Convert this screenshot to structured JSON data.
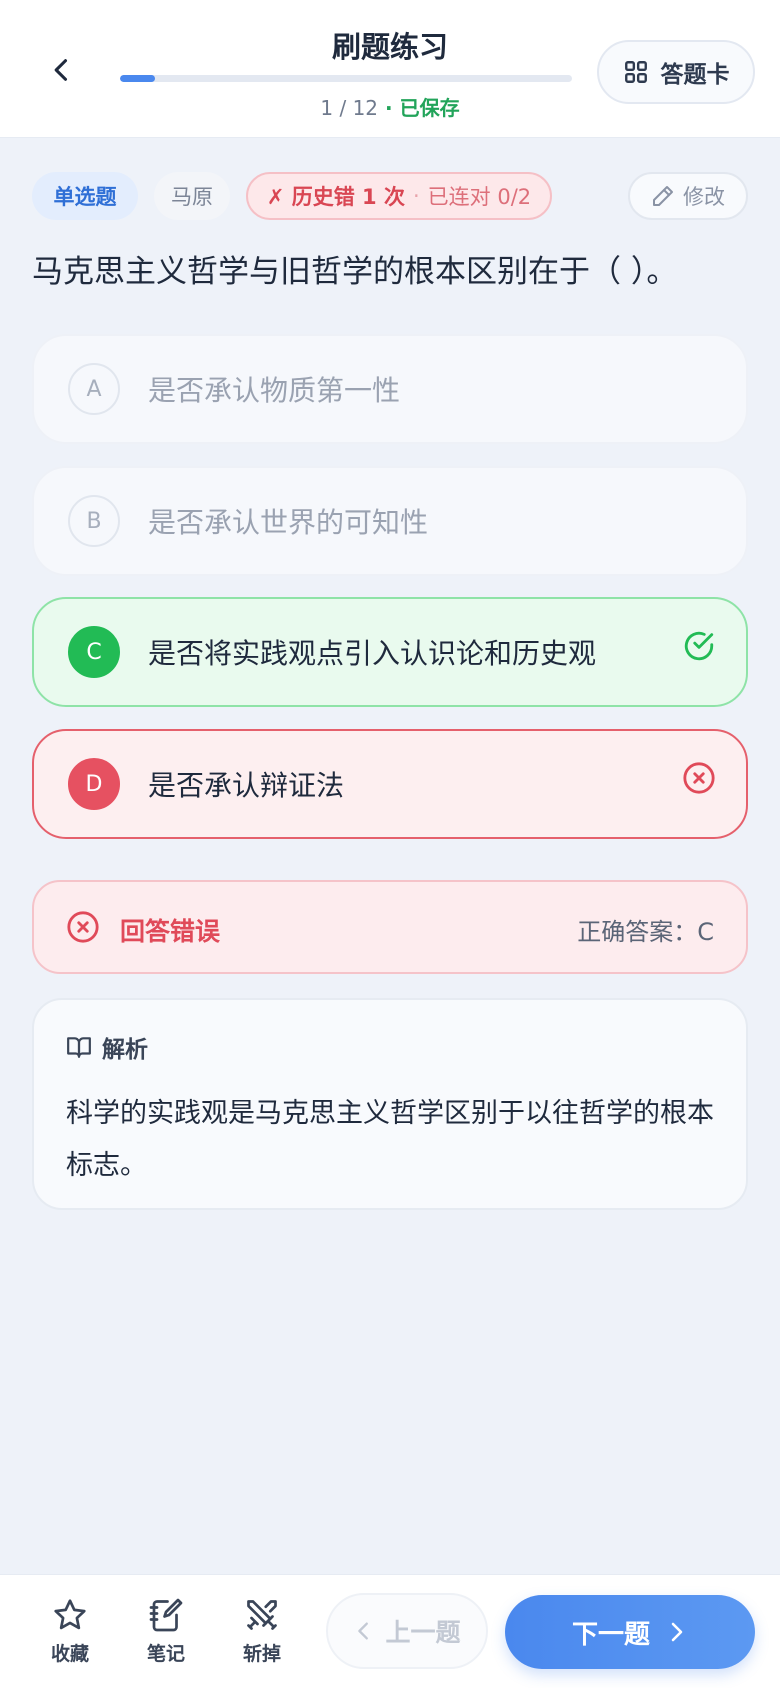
{
  "header": {
    "title": "刷题练习",
    "progress_text": "1 / 12",
    "separator": " · ",
    "saved_label": "已保存",
    "progress_fraction": 0.077,
    "answer_card_label": "答题卡"
  },
  "tags": {
    "type": "单选题",
    "subject": "马原",
    "history_error": "✗ 历史错 1 次",
    "history_dot": "·",
    "history_streak": "已连对 0/2",
    "edit_label": "修改"
  },
  "question": "马克思主义哲学与旧哲学的根本区别在于（ ）。",
  "options": [
    {
      "letter": "A",
      "text": "是否承认物质第一性"
    },
    {
      "letter": "B",
      "text": "是否承认世界的可知性"
    },
    {
      "letter": "C",
      "text": "是否将实践观点引入认识论和历史观"
    },
    {
      "letter": "D",
      "text": "是否承认辩证法"
    }
  ],
  "result": {
    "label": "回答错误",
    "correct_answer": "正确答案：C"
  },
  "analysis": {
    "title": "解析",
    "body": "科学的实践观是马克思主义哲学区别于以往哲学的根本标志。"
  },
  "bottom": {
    "favorite": "收藏",
    "note": "笔记",
    "skip": "斩掉",
    "prev": "上一题",
    "next": "下一题"
  },
  "colors": {
    "accent": "#4a88ee",
    "correct": "#22bb55",
    "wrong": "#e65161",
    "saved": "#22a45a"
  },
  "icons": {
    "back": "chevron-left-icon",
    "answer_card": "grid-icon",
    "edit": "pencil-icon",
    "correct": "check-circle-icon",
    "wrong": "x-circle-icon",
    "analysis": "book-icon",
    "favorite": "star-icon",
    "note": "notebook-icon",
    "skip": "swords-icon"
  }
}
